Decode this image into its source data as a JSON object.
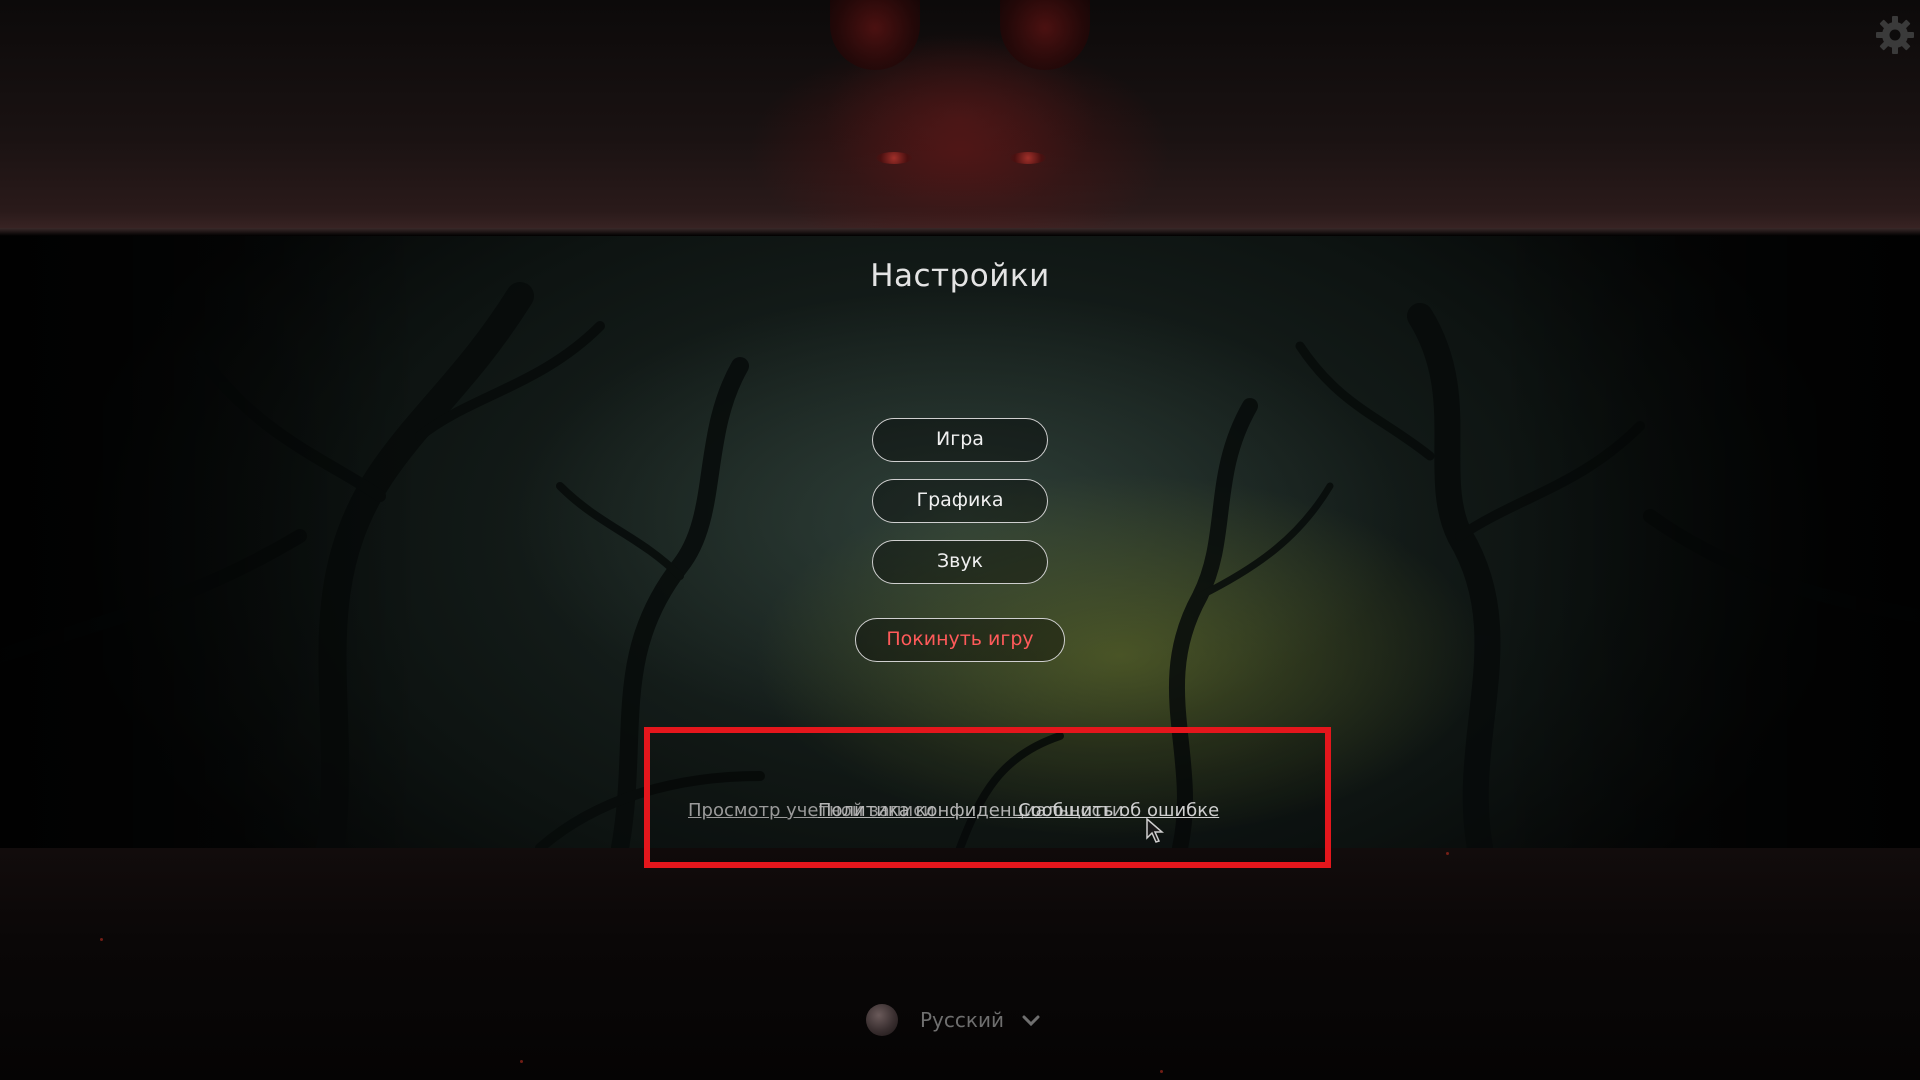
{
  "header": {
    "settings_icon": "gear-icon"
  },
  "menu": {
    "title": "Настройки",
    "buttons": {
      "game": "Игра",
      "graphics": "Графика",
      "sound": "Звук",
      "quit": "Покинуть игру"
    }
  },
  "footer_links": {
    "account": "Просмотр учетной записи",
    "privacy": "Политика конфиденциальности",
    "report": "Сообщить об ошибке"
  },
  "language": {
    "selected": "Русский",
    "icon": "globe-icon"
  },
  "colors": {
    "quit_text": "#ff5a5a",
    "highlight_border": "#e4161c"
  }
}
